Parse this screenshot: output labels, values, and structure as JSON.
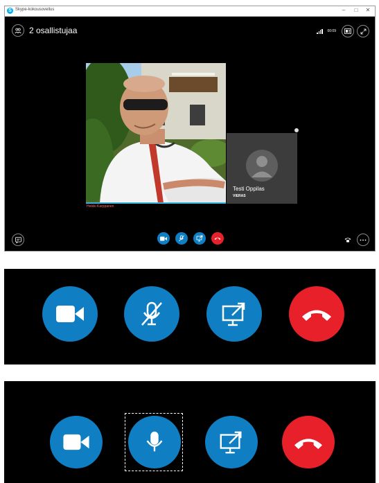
{
  "window": {
    "title": "Skype-kokousovellus",
    "app_icon_glyph": "S",
    "minimize_glyph": "–",
    "maximize_glyph": "□",
    "close_glyph": "✕"
  },
  "header": {
    "participants_label": "2 osallistujaa",
    "timer": "00:09"
  },
  "participants": {
    "main_caller_name": "Heikki Karppanen",
    "guest_name": "Testi Oppilas",
    "guest_role": "VIERAS"
  },
  "colors": {
    "accent_blue": "#0f7ec2",
    "hangup_red": "#e8202a",
    "video_bar": "#3aaee0"
  },
  "controls": [
    {
      "name": "video",
      "icon": "video-camera-icon"
    },
    {
      "name": "mute",
      "icon": "microphone-muted-icon"
    },
    {
      "name": "share",
      "icon": "present-screen-icon"
    },
    {
      "name": "hang-up",
      "icon": "phone-hangup-icon"
    }
  ]
}
